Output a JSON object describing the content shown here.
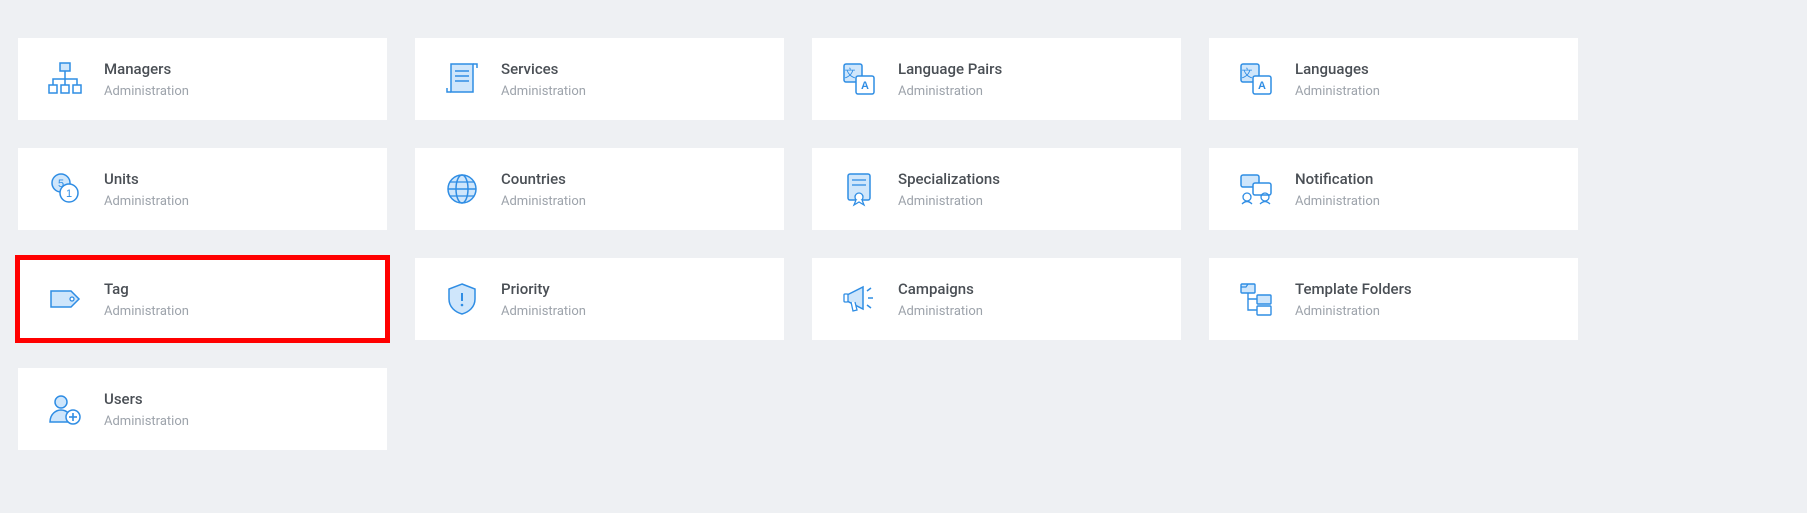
{
  "colors": {
    "iconStroke": "#2f8de4",
    "iconFill": "#cfe6fb",
    "highlight": "#ff0000"
  },
  "cards": [
    {
      "id": "managers",
      "title": "Managers",
      "subtitle": "Administration",
      "icon": "hierarchy-icon",
      "highlighted": false
    },
    {
      "id": "services",
      "title": "Services",
      "subtitle": "Administration",
      "icon": "scroll-icon",
      "highlighted": false
    },
    {
      "id": "language-pairs",
      "title": "Language Pairs",
      "subtitle": "Administration",
      "icon": "translate-icon",
      "highlighted": false
    },
    {
      "id": "languages",
      "title": "Languages",
      "subtitle": "Administration",
      "icon": "translate-icon",
      "highlighted": false
    },
    {
      "id": "units",
      "title": "Units",
      "subtitle": "Administration",
      "icon": "coins-icon",
      "highlighted": false
    },
    {
      "id": "countries",
      "title": "Countries",
      "subtitle": "Administration",
      "icon": "globe-icon",
      "highlighted": false
    },
    {
      "id": "specializations",
      "title": "Specializations",
      "subtitle": "Administration",
      "icon": "certificate-icon",
      "highlighted": false
    },
    {
      "id": "notification",
      "title": "Notification",
      "subtitle": "Administration",
      "icon": "chat-icon",
      "highlighted": false
    },
    {
      "id": "tag",
      "title": "Tag",
      "subtitle": "Administration",
      "icon": "tag-icon",
      "highlighted": true
    },
    {
      "id": "priority",
      "title": "Priority",
      "subtitle": "Administration",
      "icon": "shield-icon",
      "highlighted": false
    },
    {
      "id": "campaigns",
      "title": "Campaigns",
      "subtitle": "Administration",
      "icon": "megaphone-icon",
      "highlighted": false
    },
    {
      "id": "template-folders",
      "title": "Template Folders",
      "subtitle": "Administration",
      "icon": "folders-tree-icon",
      "highlighted": false
    },
    {
      "id": "users",
      "title": "Users",
      "subtitle": "Administration",
      "icon": "user-plus-icon",
      "highlighted": false
    }
  ]
}
